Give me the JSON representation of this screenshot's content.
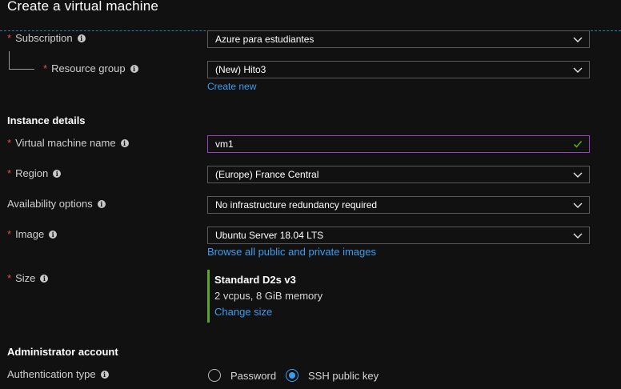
{
  "page": {
    "title": "Create a virtual machine"
  },
  "project": {
    "subscription": {
      "label": "Subscription",
      "value": "Azure para estudiantes"
    },
    "resource_group": {
      "label": "Resource group",
      "value": "(New) Hito3",
      "create_new": "Create new"
    }
  },
  "instance": {
    "heading": "Instance details",
    "vm_name": {
      "label": "Virtual machine name",
      "value": "vm1"
    },
    "region": {
      "label": "Region",
      "value": "(Europe) France Central"
    },
    "availability": {
      "label": "Availability options",
      "value": "No infrastructure redundancy required"
    },
    "image": {
      "label": "Image",
      "value": "Ubuntu Server 18.04 LTS",
      "browse_link": "Browse all public and private images"
    },
    "size": {
      "label": "Size",
      "name": "Standard D2s v3",
      "spec": "2 vcpus, 8 GiB memory",
      "change_link": "Change size"
    }
  },
  "admin": {
    "heading": "Administrator account",
    "auth_type": {
      "label": "Authentication type",
      "options": [
        "Password",
        "SSH public key"
      ],
      "selected": "SSH public key"
    }
  },
  "colors": {
    "accent": "#3b9df0",
    "required": "#e0504a",
    "valid": "#5ea61f",
    "focus": "#9b3fc7"
  },
  "icons": {
    "info": "info-icon",
    "dropdown": "chevron-down-icon",
    "valid": "checkmark-icon"
  }
}
